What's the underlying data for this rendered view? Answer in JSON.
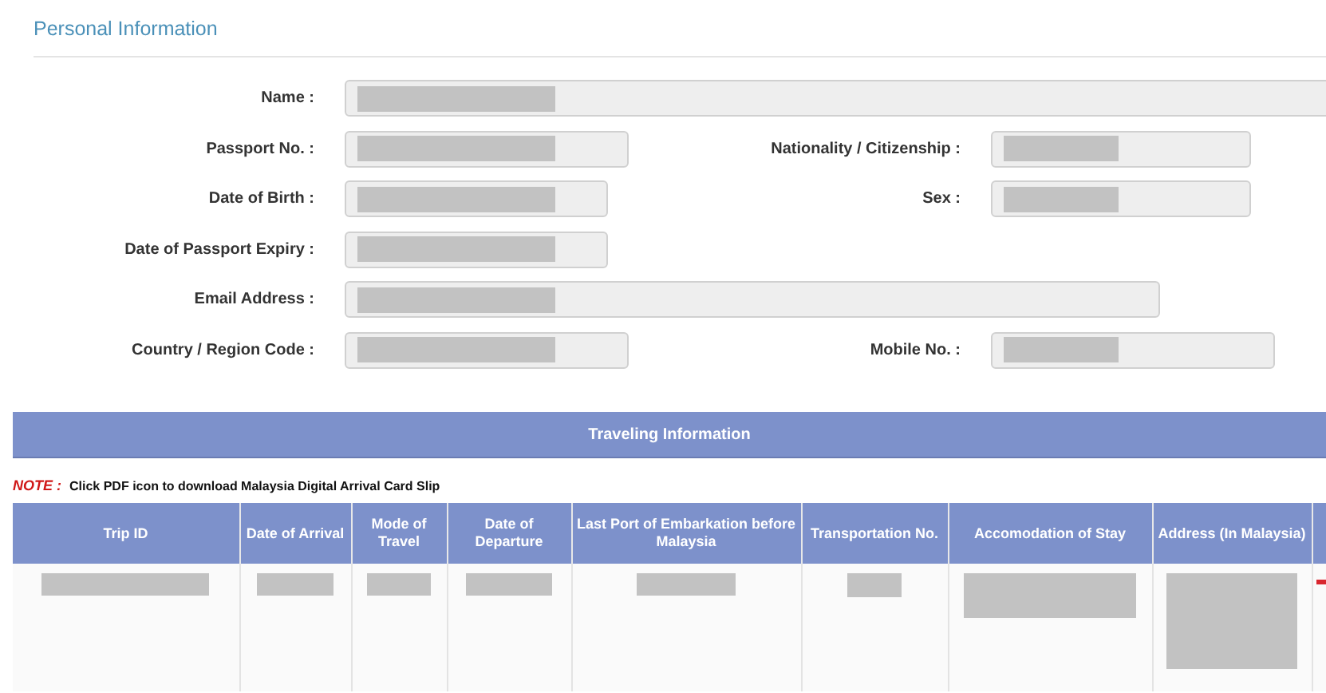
{
  "section_title": "Personal Information",
  "fields": [
    {
      "label": "Name :",
      "redacted": true
    },
    {
      "label": "Passport No. :",
      "redacted": true,
      "pair": {
        "label": "Nationality / Citizenship :",
        "redacted": true
      }
    },
    {
      "label": "Date of Birth :",
      "redacted": true,
      "pair": {
        "label": "Sex :",
        "redacted": true
      }
    },
    {
      "label": "Date of Passport Expiry :",
      "redacted": true
    },
    {
      "label": "Email Address :",
      "redacted": true
    },
    {
      "label": "Country / Region Code :",
      "redacted": true,
      "pair": {
        "label": "Mobile No. :",
        "redacted": true
      }
    }
  ],
  "travel_header": "Traveling Information",
  "note": {
    "label": "NOTE :",
    "text": "Click PDF icon to download Malaysia Digital Arrival Card Slip"
  },
  "table": {
    "columns": [
      "Trip ID",
      "Date of Arrival",
      "Mode of Travel",
      "Date of Departure",
      "Last Port of Embarkation before Malaysia",
      "Transportation No.",
      "Accomodation of Stay",
      "Address (In Malaysia)"
    ],
    "rows": [
      {
        "cells": [
          {
            "redacted": true
          },
          {
            "redacted": true
          },
          {
            "redacted": true
          },
          {
            "redacted": true
          },
          {
            "redacted": true
          },
          {
            "redacted": true
          },
          {
            "redacted": true
          },
          {
            "redacted": true
          }
        ]
      }
    ]
  }
}
